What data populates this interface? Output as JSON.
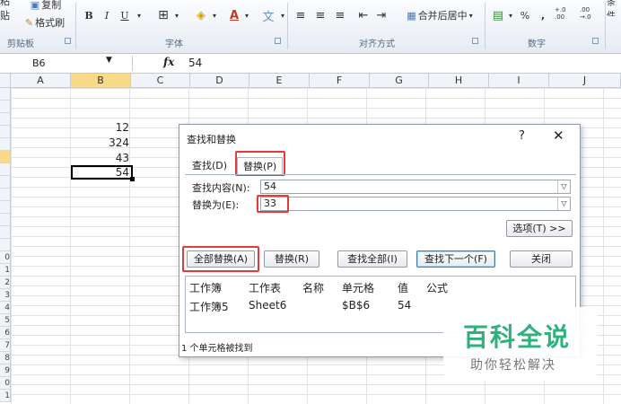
{
  "ribbon": {
    "paste_label": "粘贴",
    "copy_label": "复制",
    "format_painter_label": "格式刷",
    "bold_label": "B",
    "italic_label": "I",
    "underline_label": "U",
    "groups": {
      "clipboard": "剪贴板",
      "font": "字体",
      "alignment": "对齐方式",
      "number": "数字"
    },
    "merge_center_label": "合并后居中",
    "percent_label": "%",
    "comma_label": ",",
    "inc_decimal_label": "+.0 .00",
    "dec_decimal_label": ".00 →.0",
    "cond_format_label": "条件"
  },
  "formula_bar": {
    "name_box": "B6",
    "fx": "fx",
    "value": "54"
  },
  "grid": {
    "columns": [
      "A",
      "B",
      "C",
      "D",
      "E",
      "F",
      "G",
      "H",
      "I",
      "J"
    ],
    "rows": [
      "",
      "",
      "",
      "",
      "",
      "",
      "",
      "",
      "",
      "",
      "",
      "",
      "",
      "0",
      "1",
      "2",
      "3",
      "4",
      "5",
      "6",
      "7",
      "8",
      "9",
      "0",
      "1"
    ],
    "cells": {
      "b3": "12",
      "b4": "324",
      "b5": "43",
      "b6": "54"
    }
  },
  "dialog": {
    "title": "查找和替换",
    "help": "?",
    "close": "✕",
    "tab_find": "查找(D)",
    "tab_replace": "替换(P)",
    "find_what_label": "查找内容(N):",
    "find_what_value": "54",
    "replace_with_label": "替换为(E):",
    "replace_with_value": "33",
    "options_button": "选项(T) >>",
    "replace_all_button": "全部替换(A)",
    "replace_button": "替换(R)",
    "find_all_button": "查找全部(I)",
    "find_next_button": "查找下一个(F)",
    "close_button": "关闭",
    "results": {
      "headers": [
        "工作簿",
        "工作表",
        "名称",
        "单元格",
        "值",
        "公式"
      ],
      "row": [
        "工作簿5",
        "Sheet6",
        "",
        "$B$6",
        "54",
        ""
      ]
    },
    "status": "1 个单元格被找到"
  },
  "watermark": {
    "title": "百科全说",
    "subtitle": "助你轻松解决"
  },
  "colors": {
    "highlight_red": "#e53b3b",
    "selected_header": "#f9d98a",
    "watermark_green": "#2db27c"
  }
}
